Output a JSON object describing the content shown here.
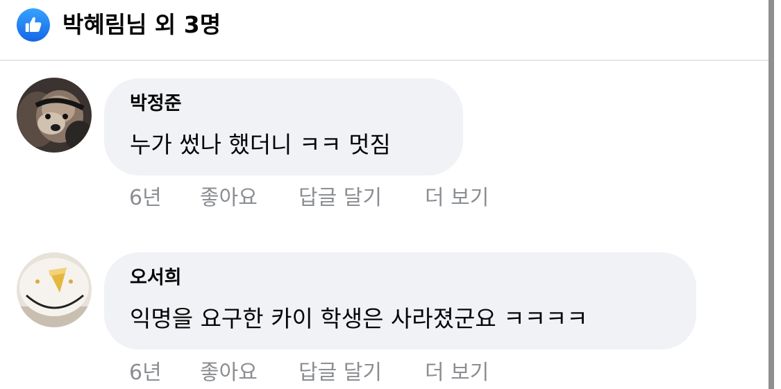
{
  "reactions": {
    "icon": "thumbs-up-icon",
    "summary": "박혜림님 외 3명",
    "accent": "#1877f2"
  },
  "comments": [
    {
      "author": "박정준",
      "text": "누가 썼나 했더니 ㅋㅋ 멋짐",
      "avatar": "dog-photo-avatar",
      "time": "6년",
      "like_label": "좋아요",
      "reply_label": "답글 달기",
      "more_label": "더 보기"
    },
    {
      "author": "오서희",
      "text": "익명을 요구한 카이 학생은 사라졌군요 ㅋㅋㅋㅋ",
      "avatar": "smiley-plate-avatar",
      "time": "6년",
      "like_label": "좋아요",
      "reply_label": "답글 달기",
      "more_label": "더 보기"
    }
  ],
  "colors": {
    "bubble": "#f0f2f5",
    "meta_text": "#8a8d91",
    "divider": "#e4e6eb"
  }
}
